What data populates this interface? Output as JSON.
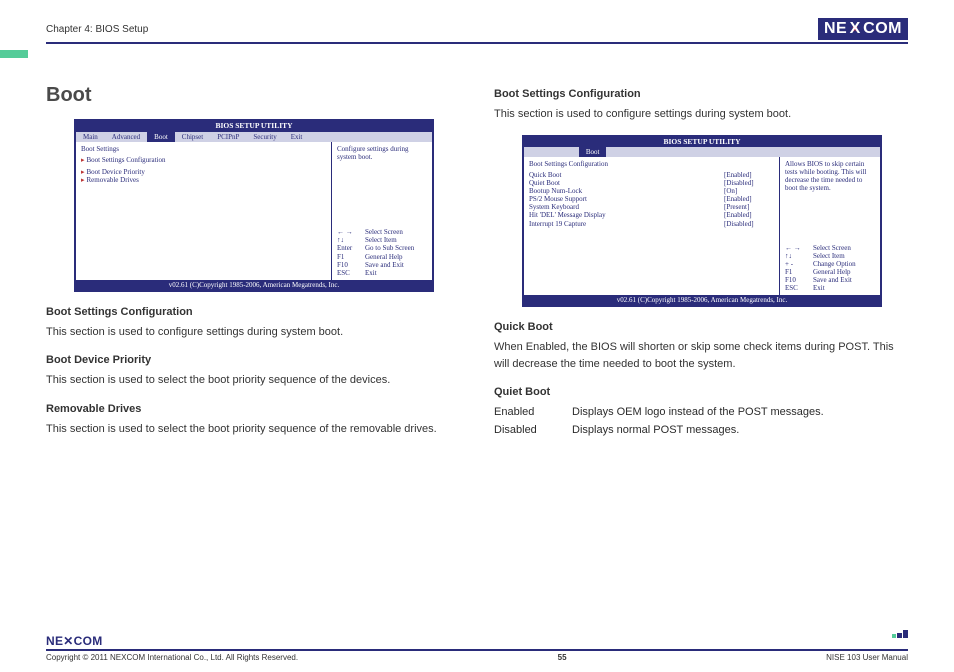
{
  "header": {
    "chapter": "Chapter 4: BIOS Setup",
    "logo_left": "NE",
    "logo_right": "COM"
  },
  "left": {
    "title": "Boot",
    "bios": {
      "title": "BIOS SETUP UTILITY",
      "tabs": [
        "Main",
        "Advanced",
        "Boot",
        "Chipset",
        "PCIPnP",
        "Security",
        "Exit"
      ],
      "main_heading": "Boot Settings",
      "items": [
        "Boot Settings Configuration",
        "Boot Device Priority",
        "Removable Drives"
      ],
      "help": "Configure settings during system boot.",
      "keys": [
        {
          "k": "← →",
          "v": "Select Screen"
        },
        {
          "k": "↑↓",
          "v": "Select Item"
        },
        {
          "k": "Enter",
          "v": "Go to Sub Screen"
        },
        {
          "k": "F1",
          "v": "General Help"
        },
        {
          "k": "F10",
          "v": "Save and Exit"
        },
        {
          "k": "ESC",
          "v": "Exit"
        }
      ],
      "footer": "v02.61 (C)Copyright 1985-2006, American Megatrends, Inc."
    },
    "sec1_h": "Boot Settings Configuration",
    "sec1_p": "This section is used to configure settings during system boot.",
    "sec2_h": "Boot Device Priority",
    "sec2_p": "This section is used to select the boot priority sequence of the devices.",
    "sec3_h": "Removable Drives",
    "sec3_p": "This section is used to select the boot priority sequence of the removable drives."
  },
  "right": {
    "top_h": "Boot Settings Configuration",
    "top_p": "This section is used to configure settings during system boot.",
    "bios": {
      "title": "BIOS SETUP UTILITY",
      "tab": "Boot",
      "main_heading": "Boot Settings Configuration",
      "rows": [
        {
          "l": "Quick Boot",
          "v": "[Enabled]"
        },
        {
          "l": "Quiet Boot",
          "v": "[Disabled]"
        },
        {
          "l": "Bootup Num-Lock",
          "v": "[On]"
        },
        {
          "l": "PS/2 Mouse Support",
          "v": "[Enabled]"
        },
        {
          "l": "System Keyboard",
          "v": "[Present]"
        },
        {
          "l": "Hit 'DEL' Message Display",
          "v": "[Enabled]"
        },
        {
          "l": "Interrupt 19 Capture",
          "v": "[Disabled]"
        }
      ],
      "help": "Allows BIOS to skip certain tests while booting. This will decrease the time needed to boot the system.",
      "keys": [
        {
          "k": "← →",
          "v": "Select Screen"
        },
        {
          "k": "↑↓",
          "v": "Select Item"
        },
        {
          "k": "+ -",
          "v": "Change Option"
        },
        {
          "k": "F1",
          "v": "General Help"
        },
        {
          "k": "F10",
          "v": "Save and Exit"
        },
        {
          "k": "ESC",
          "v": "Exit"
        }
      ],
      "footer": "v02.61 (C)Copyright 1985-2006, American Megatrends, Inc."
    },
    "qb_h": "Quick Boot",
    "qb_p": "When Enabled, the BIOS will shorten or skip some check items during POST. This will decrease the time needed to boot the system.",
    "qu_h": "Quiet Boot",
    "qu_rows": [
      {
        "k": "Enabled",
        "v": "Displays OEM logo instead of the POST messages."
      },
      {
        "k": "Disabled",
        "v": "Displays normal POST messages."
      }
    ]
  },
  "footer": {
    "logo": "NE✕COM",
    "copyright": "Copyright © 2011 NEXCOM International Co., Ltd. All Rights Reserved.",
    "page": "55",
    "doc": "NISE 103 User Manual"
  }
}
